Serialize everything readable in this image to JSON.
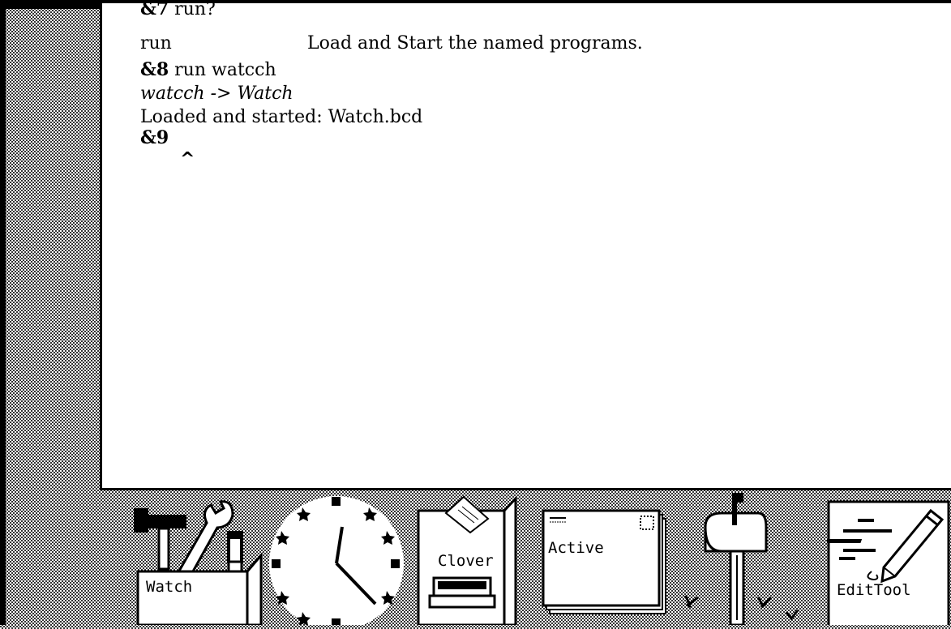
{
  "executive": {
    "lines": [
      {
        "prompt": "&7",
        "text": " run?"
      },
      {
        "text": "run",
        "description": "Load and Start the named programs."
      },
      {
        "prompt": "&8",
        "text": " run watcch"
      },
      {
        "text": "watcch -> Watch"
      },
      {
        "text": "Loaded and started: Watch.bcd"
      },
      {
        "prompt": "&9"
      }
    ],
    "caret": "^"
  },
  "tray": {
    "icons": [
      {
        "label": "Watch",
        "icon": "toolbox-icon"
      },
      {
        "icon": "clock-icon"
      },
      {
        "label": "Clover",
        "icon": "file-drawer-icon"
      },
      {
        "label": "Active",
        "icon": "envelope-icon"
      },
      {
        "icon": "mailbox-icon"
      },
      {
        "label": "EditTool",
        "icon": "document-pencil-icon"
      }
    ]
  }
}
